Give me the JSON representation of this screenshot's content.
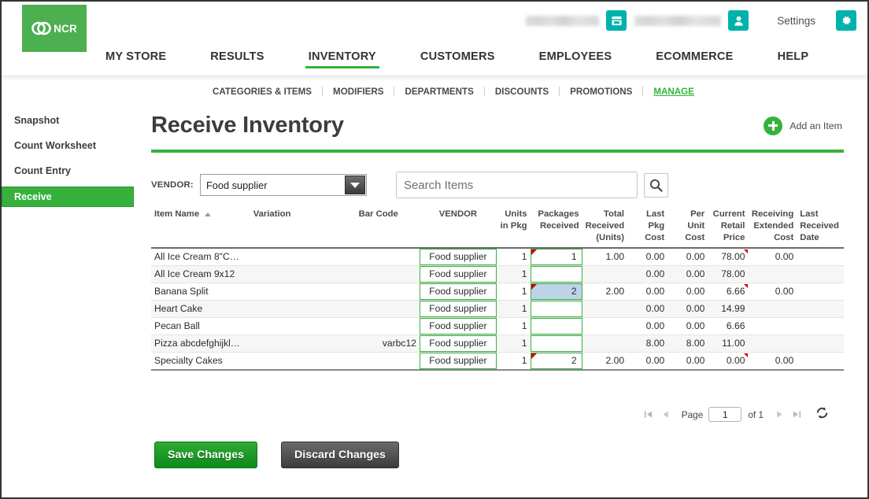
{
  "brand": {
    "logo_text": "NCR",
    "logo_color": "#4caf50"
  },
  "header": {
    "store_name_redacted": "",
    "user_name_redacted": "",
    "settings_label": "Settings",
    "icons": {
      "store": "store-icon",
      "user": "user-icon",
      "gear": "gear-icon"
    },
    "accent_teal": "#00b2ac"
  },
  "mainnav": {
    "items": [
      {
        "label": "MY STORE",
        "active": false
      },
      {
        "label": "RESULTS",
        "active": false
      },
      {
        "label": "INVENTORY",
        "active": true
      },
      {
        "label": "CUSTOMERS",
        "active": false
      },
      {
        "label": "EMPLOYEES",
        "active": false
      },
      {
        "label": "ECOMMERCE",
        "active": false
      },
      {
        "label": "HELP",
        "active": false
      }
    ],
    "active_color": "#36b23c"
  },
  "subnav": {
    "items": [
      {
        "label": "CATEGORIES & ITEMS",
        "active": false
      },
      {
        "label": "MODIFIERS",
        "active": false
      },
      {
        "label": "DEPARTMENTS",
        "active": false
      },
      {
        "label": "DISCOUNTS",
        "active": false
      },
      {
        "label": "PROMOTIONS",
        "active": false
      },
      {
        "label": "MANAGE",
        "active": true
      }
    ]
  },
  "sidebar": {
    "items": [
      {
        "label": "Snapshot",
        "active": false
      },
      {
        "label": "Count Worksheet",
        "active": false
      },
      {
        "label": "Count Entry",
        "active": false
      },
      {
        "label": "Receive",
        "active": true
      }
    ]
  },
  "page": {
    "title": "Receive Inventory",
    "add_item_label": "Add an Item",
    "rule_color": "#36b23c"
  },
  "filters": {
    "vendor_label": "VENDOR:",
    "vendor_value": "Food supplier",
    "vendor_options": [
      "Food supplier"
    ],
    "search_placeholder": "Search Items",
    "search_value": "",
    "search_icon": "search-icon"
  },
  "table": {
    "columns": [
      "Item Name",
      "Variation",
      "Bar Code",
      "VENDOR",
      "Units in Pkg",
      "Packages Received",
      "Total Received (Units)",
      "Last Pkg Cost",
      "Per Unit Cost",
      "Current Retail Price",
      "Receiving Extended Cost",
      "Last Received Date"
    ],
    "sort_column": "Item Name",
    "sort_direction": "asc",
    "rows": [
      {
        "item_name": "All Ice Cream 8\"C…",
        "variation": "",
        "bar_code": "",
        "vendor": "Food supplier",
        "units_in_pkg": "1",
        "packages_received": "1",
        "packages_selected": false,
        "packages_marked": true,
        "total_received": "1.00",
        "last_pkg_cost": "0.00",
        "per_unit_cost": "0.00",
        "current_retail_price": "78.00",
        "retail_marked": true,
        "receiving_extended_cost": "0.00",
        "last_received_date": ""
      },
      {
        "item_name": "All Ice Cream 9x12",
        "variation": "",
        "bar_code": "",
        "vendor": "Food supplier",
        "units_in_pkg": "1",
        "packages_received": "",
        "packages_selected": false,
        "packages_marked": false,
        "total_received": "",
        "last_pkg_cost": "0.00",
        "per_unit_cost": "0.00",
        "current_retail_price": "78.00",
        "retail_marked": false,
        "receiving_extended_cost": "",
        "last_received_date": ""
      },
      {
        "item_name": "Banana Split",
        "variation": "",
        "bar_code": "",
        "vendor": "Food supplier",
        "units_in_pkg": "1",
        "packages_received": "2",
        "packages_selected": true,
        "packages_marked": true,
        "total_received": "2.00",
        "last_pkg_cost": "0.00",
        "per_unit_cost": "0.00",
        "current_retail_price": "6.66",
        "retail_marked": true,
        "receiving_extended_cost": "0.00",
        "last_received_date": ""
      },
      {
        "item_name": "Heart Cake",
        "variation": "",
        "bar_code": "",
        "vendor": "Food supplier",
        "units_in_pkg": "1",
        "packages_received": "",
        "packages_selected": false,
        "packages_marked": false,
        "total_received": "",
        "last_pkg_cost": "0.00",
        "per_unit_cost": "0.00",
        "current_retail_price": "14.99",
        "retail_marked": false,
        "receiving_extended_cost": "",
        "last_received_date": ""
      },
      {
        "item_name": "Pecan Ball",
        "variation": "",
        "bar_code": "",
        "vendor": "Food supplier",
        "units_in_pkg": "1",
        "packages_received": "",
        "packages_selected": false,
        "packages_marked": false,
        "total_received": "",
        "last_pkg_cost": "0.00",
        "per_unit_cost": "0.00",
        "current_retail_price": "6.66",
        "retail_marked": false,
        "receiving_extended_cost": "",
        "last_received_date": ""
      },
      {
        "item_name": "Pizza abcdefghijkl…",
        "variation": "",
        "bar_code": "varbc12",
        "vendor": "Food supplier",
        "units_in_pkg": "1",
        "packages_received": "",
        "packages_selected": false,
        "packages_marked": false,
        "total_received": "",
        "last_pkg_cost": "8.00",
        "per_unit_cost": "8.00",
        "current_retail_price": "11.00",
        "retail_marked": false,
        "receiving_extended_cost": "",
        "last_received_date": ""
      },
      {
        "item_name": "Specialty Cakes",
        "variation": "",
        "bar_code": "",
        "vendor": "Food supplier",
        "units_in_pkg": "1",
        "packages_received": "2",
        "packages_selected": false,
        "packages_marked": true,
        "total_received": "2.00",
        "last_pkg_cost": "0.00",
        "per_unit_cost": "0.00",
        "current_retail_price": "0.00",
        "retail_marked": true,
        "receiving_extended_cost": "0.00",
        "last_received_date": ""
      }
    ]
  },
  "pager": {
    "page_label": "Page",
    "page_value": "1",
    "of_label": "of 1",
    "first_icon": "first-page-icon",
    "prev_icon": "previous-page-icon",
    "next_icon": "next-page-icon",
    "last_icon": "last-page-icon",
    "refresh_icon": "refresh-icon"
  },
  "footer": {
    "save_label": "Save Changes",
    "discard_label": "Discard Changes"
  }
}
